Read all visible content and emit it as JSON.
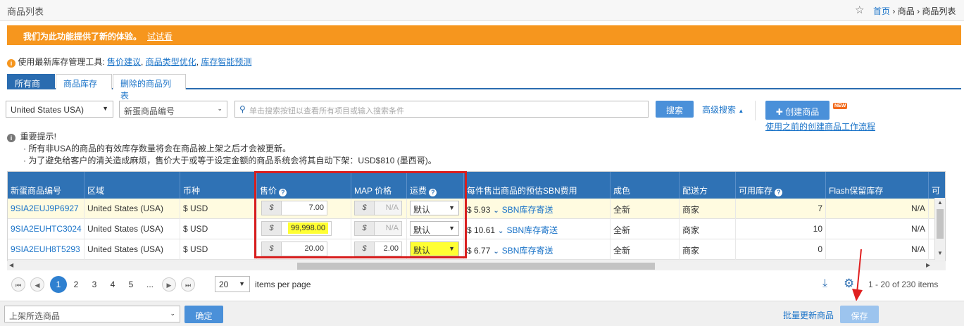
{
  "header": {
    "title": "商品列表",
    "breadcrumb": {
      "home": "首页",
      "section": "商品",
      "current": "商品列表"
    }
  },
  "promo": {
    "text": "我们为此功能提供了新的体验。",
    "link": "试试看"
  },
  "tools": {
    "prefix": "使用最新库存管理工具:",
    "links": [
      "售价建议",
      "商品类型优化",
      "库存智能预测"
    ]
  },
  "tabs": [
    "所有商品",
    "商品库存",
    "删除的商品列表"
  ],
  "filters": {
    "country": "United States USA)",
    "field": "新蛋商品编号",
    "search_placeholder": "单击搜索按钮以查看所有项目或输入搜索条件",
    "search_button": "搜索",
    "advanced": "高级搜索",
    "create_button": "创建商品",
    "new_badge": "NEW",
    "old_flow_link": "使用之前的创建商品工作流程"
  },
  "notice": {
    "title": "重要提示!",
    "lines": [
      "· 所有非USA的商品的有效库存数量将会在商品被上架之后才会被更新。",
      "· 为了避免给客户的清关造成麻烦，售价大于或等于设定金额的商品系统会将其自动下架：USD$810 (墨西哥)。"
    ]
  },
  "table": {
    "headers": [
      "新蛋商品编号",
      "区域",
      "币种",
      "售价",
      "MAP 价格",
      "运费",
      "每件售出商品的预估SBN费用",
      "成色",
      "配送方",
      "可用库存",
      "Flash保留库存",
      "可"
    ],
    "rows": [
      {
        "sku": "9SIA2EUJ9P6927",
        "region": "United States (USA)",
        "currency": "$ USD",
        "cur_symbol": "$",
        "price": "7.00",
        "map": "N/A",
        "shipping": "默认",
        "sbn_fee": "$ 5.93",
        "sbn_link": "SBN库存寄送",
        "condition": "全新",
        "fulfill": "商家",
        "stock": "7",
        "flash": "N/A"
      },
      {
        "sku": "9SIA2EUHTC3024",
        "region": "United States (USA)",
        "currency": "$ USD",
        "cur_symbol": "$",
        "price": "99,998.00",
        "map": "N/A",
        "shipping": "默认",
        "sbn_fee": "$ 10.61",
        "sbn_link": "SBN库存寄送",
        "condition": "全新",
        "fulfill": "商家",
        "stock": "10",
        "flash": "N/A"
      },
      {
        "sku": "9SIA2EUH8T5293",
        "region": "United States (USA)",
        "currency": "$ USD",
        "cur_symbol": "$",
        "price": "20.00",
        "map": "2.00",
        "shipping": "默认",
        "sbn_fee": "$ 6.77",
        "sbn_link": "SBN库存寄送",
        "condition": "全新",
        "fulfill": "商家",
        "stock": "0",
        "flash": "N/A"
      }
    ]
  },
  "pagination": {
    "pages": [
      "1",
      "2",
      "3",
      "4",
      "5",
      "..."
    ],
    "per_page": "20",
    "per_page_label": "items per page",
    "summary": "1 - 20 of 230 items"
  },
  "bottom": {
    "action_select": "上架所选商品",
    "confirm": "确定",
    "bulk_update": "批量更新商品",
    "save": "保存"
  },
  "colors": {
    "accent": "#2f72b5",
    "promo": "#f6961e",
    "highlight": "#ffff33",
    "annotation": "#d81e1e"
  }
}
